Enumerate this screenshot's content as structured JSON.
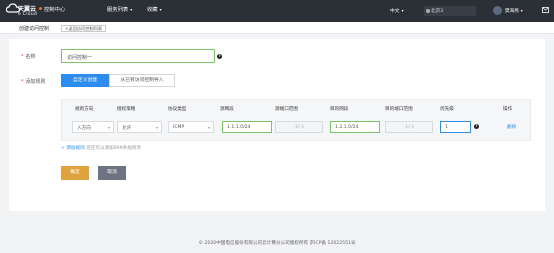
{
  "header": {
    "brand": "天翼云",
    "brand_sub": "e Cloud",
    "console": "控制中心",
    "nav": [
      {
        "label": "服务列表"
      },
      {
        "label": "收藏"
      }
    ],
    "language": "中文",
    "region": "北京3",
    "username": "樊海燕"
  },
  "breadcrumb": {
    "title": "创建访问控制",
    "back_label": "<返回访问控制列表"
  },
  "form": {
    "name_label": "名称",
    "name_value": "访问控制一",
    "rule_label": "添加规则",
    "mode_custom": "自定义创建",
    "mode_import": "从已有访问控制导入"
  },
  "rule_table": {
    "headers": [
      "规则方向",
      "授权策略",
      "协议类型",
      "源网段",
      "源端口范围",
      "目的网段",
      "目的端口范围",
      "优先级",
      "操作"
    ],
    "row": {
      "direction": "入方向",
      "policy": "允许",
      "protocol": "ICMP",
      "source_cidr": "1.1.1.0/24",
      "source_ports": "-1/-1",
      "dest_cidr": "1.2.1.0/24",
      "dest_ports": "-1/-1",
      "priority": "1",
      "action": "删除"
    }
  },
  "add_rule": {
    "plus": "+",
    "link": "添加规则",
    "hint": "您还可以添加999条规则项"
  },
  "actions": {
    "ok": "确定",
    "cancel": "取消"
  },
  "footer": {
    "text": "© 2020中国电信股份有限公司云计算分公司版权所有 京ICP备 12022551号"
  },
  "colors": {
    "topbar": "#2b2f36",
    "primary": "#2d8cf0",
    "valid": "#7cc26a",
    "ok_button": "#e0a23c",
    "cancel_button": "#6b7480"
  },
  "icons": {
    "logo": "cloud-icon",
    "region": "location-icon",
    "mail": "mail-icon",
    "help": "question-icon"
  }
}
